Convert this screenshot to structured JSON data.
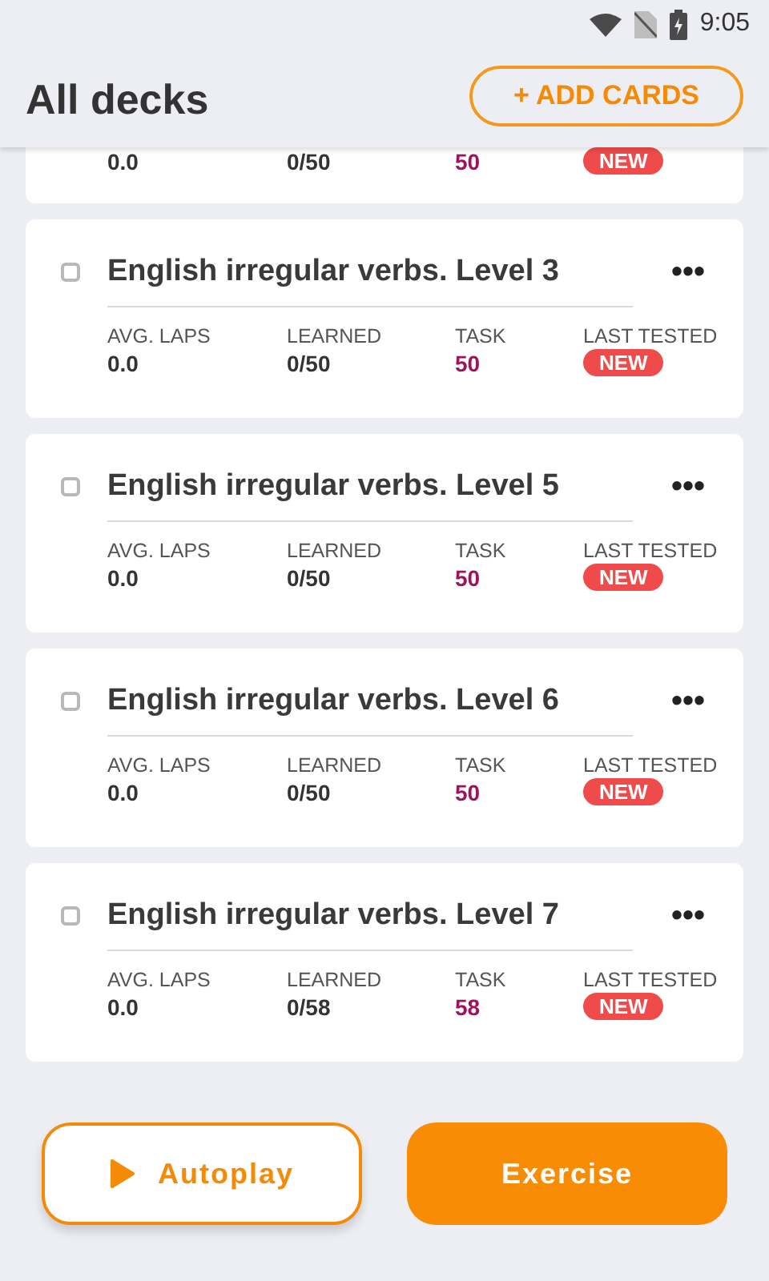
{
  "status_bar": {
    "time": "9:05"
  },
  "header": {
    "title": "All decks",
    "add_button": "+ ADD CARDS"
  },
  "decks": [
    {
      "kind": "clipped",
      "stats": [
        {
          "value": "0.0",
          "kind": "plain"
        },
        {
          "value": "0/50",
          "kind": "plain"
        },
        {
          "value": "50",
          "kind": "task"
        },
        {
          "value": "NEW",
          "kind": "badge"
        }
      ]
    },
    {
      "kind": "full",
      "title": "English irregular verbs. Level 3",
      "checked": false,
      "menu": "•••",
      "stats": [
        {
          "label": "AVG. LAPS",
          "value": "0.0",
          "kind": "plain"
        },
        {
          "label": "LEARNED",
          "value": "0/50",
          "kind": "plain"
        },
        {
          "label": "TASK",
          "value": "50",
          "kind": "task"
        },
        {
          "label": "LAST TESTED",
          "value": "NEW",
          "kind": "badge"
        }
      ]
    },
    {
      "kind": "full",
      "title": "English irregular verbs. Level 5",
      "checked": false,
      "menu": "•••",
      "stats": [
        {
          "label": "AVG. LAPS",
          "value": "0.0",
          "kind": "plain"
        },
        {
          "label": "LEARNED",
          "value": "0/50",
          "kind": "plain"
        },
        {
          "label": "TASK",
          "value": "50",
          "kind": "task"
        },
        {
          "label": "LAST TESTED",
          "value": "NEW",
          "kind": "badge"
        }
      ]
    },
    {
      "kind": "full",
      "title": "English irregular verbs. Level 6",
      "checked": false,
      "menu": "•••",
      "stats": [
        {
          "label": "AVG. LAPS",
          "value": "0.0",
          "kind": "plain"
        },
        {
          "label": "LEARNED",
          "value": "0/50",
          "kind": "plain"
        },
        {
          "label": "TASK",
          "value": "50",
          "kind": "task"
        },
        {
          "label": "LAST TESTED",
          "value": "NEW",
          "kind": "badge"
        }
      ]
    },
    {
      "kind": "full",
      "title": "English irregular verbs. Level 7",
      "checked": false,
      "menu": "•••",
      "stats": [
        {
          "label": "AVG. LAPS",
          "value": "0.0",
          "kind": "plain"
        },
        {
          "label": "LEARNED",
          "value": "0/58",
          "kind": "plain"
        },
        {
          "label": "TASK",
          "value": "58",
          "kind": "task"
        },
        {
          "label": "LAST TESTED",
          "value": "NEW",
          "kind": "badge"
        }
      ]
    }
  ],
  "actions": {
    "autoplay": "Autoplay",
    "exercise": "Exercise"
  }
}
